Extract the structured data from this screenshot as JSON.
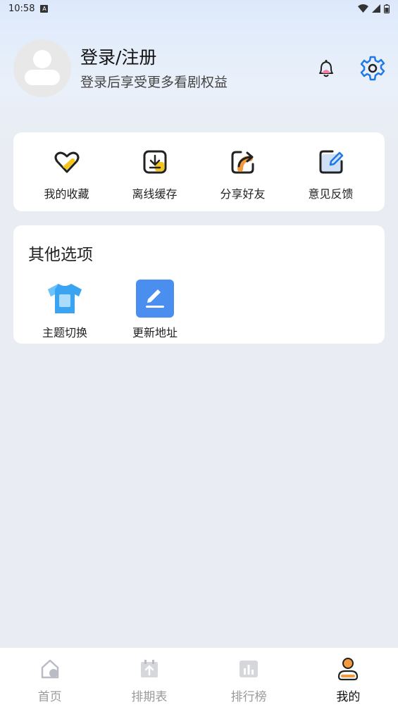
{
  "status_bar": {
    "time": "10:58",
    "notification_icon": "a-icon",
    "right_icons": [
      "wifi-icon",
      "signal-icon",
      "battery-icon"
    ]
  },
  "profile": {
    "title": "登录/注册",
    "subtitle": "登录后享受更多看剧权益"
  },
  "quick_actions": [
    {
      "label": "我的收藏",
      "icon": "heart-icon"
    },
    {
      "label": "离线缓存",
      "icon": "download-icon"
    },
    {
      "label": "分享好友",
      "icon": "share-icon"
    },
    {
      "label": "意见反馈",
      "icon": "feedback-edit-icon"
    }
  ],
  "other_options": {
    "title": "其他选项",
    "items": [
      {
        "label": "主题切换",
        "icon": "tshirt-icon"
      },
      {
        "label": "更新地址",
        "icon": "pen-edit-icon"
      }
    ]
  },
  "tabs": [
    {
      "label": "首页",
      "icon": "home-icon",
      "active": false
    },
    {
      "label": "排期表",
      "icon": "calendar-icon",
      "active": false
    },
    {
      "label": "排行榜",
      "icon": "ranking-chart-icon",
      "active": false
    },
    {
      "label": "我的",
      "icon": "user-icon",
      "active": true
    }
  ],
  "colors": {
    "accent_blue": "#1e78e6",
    "accent_yellow": "#f5c518",
    "accent_orange": "#f19a3e",
    "inactive_gray": "#9a9a9a"
  }
}
